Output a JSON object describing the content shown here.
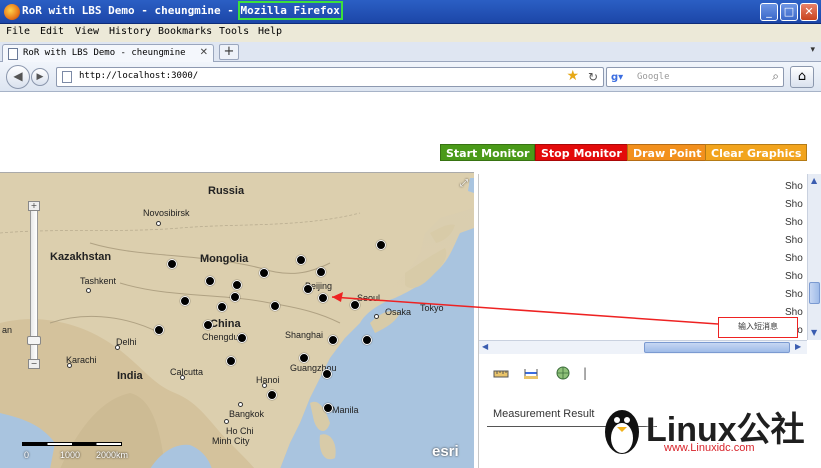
{
  "window": {
    "title_prefix": "RoR with LBS Demo - cheungmine - ",
    "title_app": "Mozilla Firefox",
    "controls": {
      "minimize": "_",
      "maximize": "□",
      "close": "✕"
    }
  },
  "menu": [
    "File",
    "Edit",
    "View",
    "History",
    "Bookmarks",
    "Tools",
    "Help"
  ],
  "tab": {
    "label": "RoR with LBS Demo - cheungmine",
    "close": "✕",
    "new": "+"
  },
  "nav": {
    "url": "http://localhost:3000/",
    "search_placeholder": "Google",
    "back": "◀",
    "forward": "▶",
    "reload": "↻",
    "home": "⌂",
    "bookmark": "★"
  },
  "toolbar": [
    {
      "label": "Start Monitor",
      "color": "#4a9a19"
    },
    {
      "label": "Stop Monitor",
      "color": "#e30b0b"
    },
    {
      "label": "Draw Point",
      "color": "#f2901d"
    },
    {
      "label": "Clear Graphics",
      "color": "#f2a41d"
    }
  ],
  "map": {
    "countries": [
      "Russia",
      "Kazakhstan",
      "Mongolia",
      "China",
      "India"
    ],
    "cities": [
      "Novosibirsk",
      "Tashkent",
      "Beijing",
      "Seoul",
      "Tokyo",
      "Osaka",
      "Shanghai",
      "Chengdu",
      "Delhi",
      "Karachi",
      "Calcutta",
      "Guangzhou",
      "Hanoi",
      "Bangkok",
      "Manila",
      "Ho Chi",
      "Minh City",
      "an"
    ],
    "scale_labels": [
      "0",
      "1000",
      "2000km"
    ],
    "attribution": "esri"
  },
  "panel": {
    "show_items": [
      "Sho",
      "Sho",
      "Sho",
      "Sho",
      "Sho",
      "Sho",
      "Sho",
      "Sho",
      "Sho"
    ],
    "measurement_title": "Measurement Result",
    "annotation": "输入短消息"
  },
  "watermark": {
    "brand": "Linux公社",
    "site": "www.Linuxidc.com"
  }
}
